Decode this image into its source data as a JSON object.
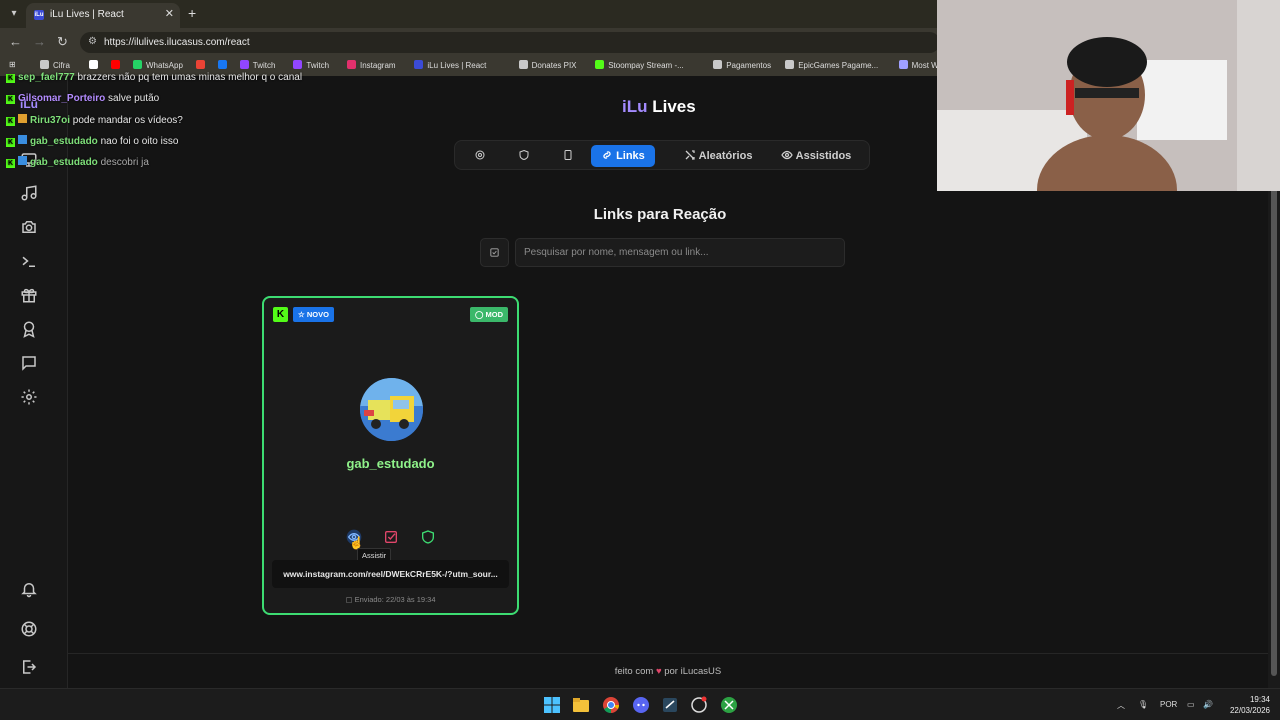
{
  "browser": {
    "tab_title": "iLu Lives | React",
    "url": "https://ilulives.ilucasus.com/react",
    "bookmarks": [
      {
        "label": "Cifra",
        "icon": "folder-icon",
        "color": "#c9c9c9"
      },
      {
        "label": "",
        "icon": "x-icon",
        "color": "#ffffff"
      },
      {
        "label": "",
        "icon": "youtube-icon",
        "color": "#ff0000"
      },
      {
        "label": "WhatsApp",
        "icon": "whatsapp-icon",
        "color": "#25d366"
      },
      {
        "label": "",
        "icon": "gmail-icon",
        "color": "#ea4335"
      },
      {
        "label": "",
        "icon": "facebook-icon",
        "color": "#1877f2"
      },
      {
        "label": "Twitch",
        "icon": "twitch-icon",
        "color": "#9146ff"
      },
      {
        "label": "Twitch",
        "icon": "twitch-icon",
        "color": "#9146ff"
      },
      {
        "label": "Instagram",
        "icon": "instagram-icon",
        "color": "#e1306c"
      },
      {
        "label": "iLu Lives | React",
        "icon": "ilu-icon",
        "color": "#3b4bd6"
      },
      {
        "label": "Donates PIX",
        "icon": "folder-icon",
        "color": "#c9c9c9"
      },
      {
        "label": "Stoompay Stream -...",
        "icon": "kick-icon",
        "color": "#53fc18"
      },
      {
        "label": "Pagamentos",
        "icon": "folder-icon",
        "color": "#c9c9c9"
      },
      {
        "label": "EpicGames Pagame...",
        "icon": "folder-icon",
        "color": "#c9c9c9"
      },
      {
        "label": "Most Watched Port...",
        "icon": "globe-icon",
        "color": "#a0a0ff"
      },
      {
        "label": "T",
        "icon": "tiktok-icon",
        "color": "#ffffff"
      }
    ]
  },
  "brand": {
    "ilu": "iLu",
    "lives": " Lives"
  },
  "nav": {
    "links": "Links",
    "random": "Aleatórios",
    "watched": "Assistidos"
  },
  "section_title": "Links para Reação",
  "search": {
    "placeholder": "Pesquisar por nome, mensagem ou link..."
  },
  "card": {
    "platform": "K",
    "badge_new": "NOVO",
    "badge_mod": "MOD",
    "username": "gab_estudado",
    "tooltip": "Assistir",
    "link": "www.instagram.com/reel/DWEkCRrE5K-/?utm_sour...",
    "sent": "Enviado: 22/03 às 19:34",
    "accent": "#3ddc72"
  },
  "footer": {
    "before": "feito com",
    "after": "por iLucasUS"
  },
  "chat": [
    {
      "user": "sep_fael777",
      "msg": "brazzers não pq tem umas minas melhor q o canal"
    },
    {
      "user": "Gilsomar_Porteiro",
      "msg": "salve putão"
    },
    {
      "user": "Riru37oi",
      "msg": "pode mandar os vídeos?"
    },
    {
      "user": "gab_estudado",
      "msg": "nao foi o oito isso"
    },
    {
      "user": "gab_estudado",
      "msg": "descobri ja"
    }
  ],
  "taskbar": {
    "lang": "POR",
    "time": "19:34",
    "date": "22/03/2026"
  }
}
